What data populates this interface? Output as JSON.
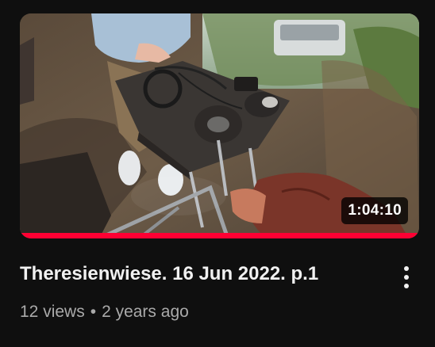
{
  "video": {
    "duration": "1:04:10",
    "watch_progress_percent": 100,
    "title": "Theresienwiese. 16 Jun 2022. p.1",
    "views": "12 views",
    "separator": "•",
    "uploaded": "2 years ago"
  },
  "colors": {
    "background": "#0f0f0f",
    "progress": "#ff0033",
    "title": "#f1f1f1",
    "meta": "#aaaaaa"
  },
  "icons": {
    "menu": "more-vert-icon"
  }
}
